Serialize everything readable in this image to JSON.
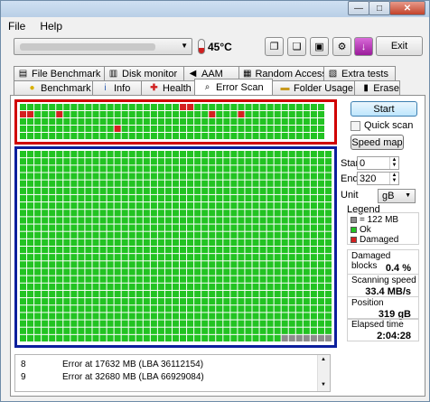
{
  "menu": [
    "File",
    "Help"
  ],
  "temperature": "45°C",
  "exit_label": "Exit",
  "tabs_row1": [
    {
      "label": "File Benchmark",
      "icon": "file-benchmark-icon"
    },
    {
      "label": "Disk monitor",
      "icon": "disk-monitor-icon"
    },
    {
      "label": "AAM",
      "icon": "speaker-icon"
    },
    {
      "label": "Random Access",
      "icon": "random-access-icon"
    },
    {
      "label": "Extra tests",
      "icon": "extra-tests-icon"
    }
  ],
  "tabs_row2": [
    {
      "label": "Benchmark",
      "icon": "lightbulb-icon"
    },
    {
      "label": "Info",
      "icon": "info-icon"
    },
    {
      "label": "Health",
      "icon": "health-cross-icon"
    },
    {
      "label": "Error Scan",
      "icon": "magnifier-icon"
    },
    {
      "label": "Folder Usage",
      "icon": "folder-icon"
    },
    {
      "label": "Erase",
      "icon": "trash-icon"
    }
  ],
  "active_tab": "Error Scan",
  "controls": {
    "start_button": "Start",
    "quick_scan": "Quick scan",
    "speed_map": "Speed map",
    "start_label": "Start",
    "start_value": "0",
    "end_label": "End",
    "end_value": "320",
    "unit_label": "Unit",
    "unit_value": "gB"
  },
  "legend": {
    "title": "Legend",
    "block_size": "= 122 MB",
    "ok": "Ok",
    "damaged": "Damaged"
  },
  "stats": {
    "damaged_label": "Damaged blocks",
    "damaged_value": "0.4 %",
    "speed_label": "Scanning speed",
    "speed_value": "33.4 MB/s",
    "position_label": "Position",
    "position_value": "319 gB",
    "elapsed_label": "Elapsed time",
    "elapsed_value": "2:04:28"
  },
  "log": [
    {
      "n": "8",
      "text": "Error at 17632 MB (LBA 36112154)"
    },
    {
      "n": "9",
      "text": "Error at 32680 MB (LBA 66929084)"
    }
  ],
  "colors": {
    "ok": "#22c322",
    "damaged": "#d42020",
    "unscanned": "#8c8c8c",
    "highlight_top": "#d00000",
    "highlight_bottom": "#0c1f9c"
  },
  "block_map": {
    "top": {
      "cols": 42,
      "rows": 5,
      "damaged_blocks": [
        [
          0,
          1
        ],
        [
          1,
          1
        ],
        [
          5,
          1
        ],
        [
          22,
          0
        ],
        [
          23,
          0
        ],
        [
          26,
          1
        ],
        [
          30,
          1
        ],
        [
          13,
          3
        ]
      ],
      "unscanned_count": 0
    },
    "main": {
      "cols": 43,
      "rows": 26,
      "unscanned_count": 7
    }
  }
}
